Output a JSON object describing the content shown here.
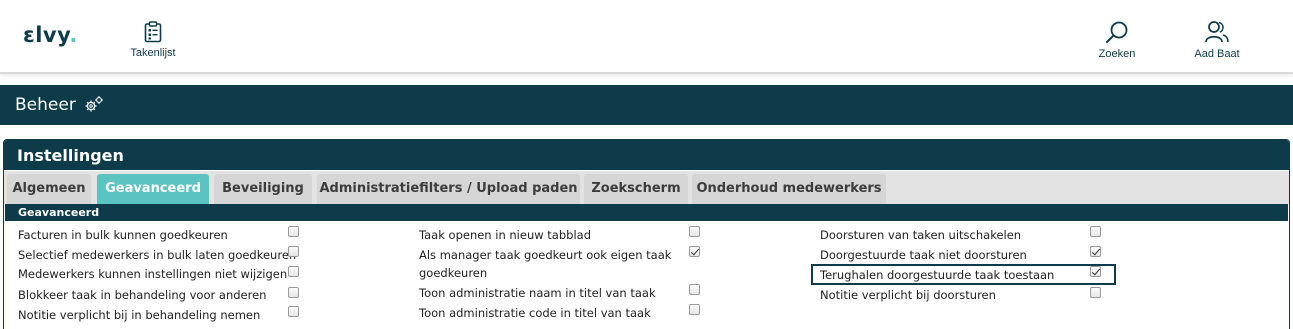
{
  "header": {
    "logo_text": "ɛlvy",
    "nav": {
      "tasks_label": "Takenlijst",
      "search_label": "Zoeken",
      "user_label": "Aad Baat"
    }
  },
  "beheer": {
    "title": "Beheer"
  },
  "panel": {
    "title": "Instellingen",
    "tabs": [
      {
        "label": "Algemeen",
        "active": false
      },
      {
        "label": "Geavanceerd",
        "active": true
      },
      {
        "label": "Beveiliging",
        "active": false
      },
      {
        "label": "Administratiefilters / Upload paden",
        "active": false
      },
      {
        "label": "Zoekscherm",
        "active": false
      },
      {
        "label": "Onderhoud medewerkers",
        "active": false
      }
    ],
    "section_title": "Geavanceerd",
    "options": {
      "col1": [
        {
          "label": "Facturen in bulk kunnen goedkeuren",
          "checked": false
        },
        {
          "label": "Selectief medewerkers in bulk laten goedkeuren",
          "checked": false
        },
        {
          "label": "Medewerkers kunnen instellingen niet wijzigen",
          "checked": false
        },
        {
          "label": "Blokkeer taak in behandeling voor anderen",
          "checked": false
        },
        {
          "label": "Notitie verplicht bij in behandeling nemen",
          "checked": false
        }
      ],
      "col2": [
        {
          "label": "Taak openen in nieuw tabblad",
          "checked": false
        },
        {
          "label": "Als manager taak goedkeurt ook eigen taak goedkeuren",
          "checked": true
        },
        {
          "label": "Toon administratie naam in titel van taak",
          "checked": false
        },
        {
          "label": "Toon administratie code in titel van taak",
          "checked": false
        }
      ],
      "col3": [
        {
          "label": "Doorsturen van taken uitschakelen",
          "checked": false
        },
        {
          "label": "Doorgestuurde taak niet doorsturen",
          "checked": true
        },
        {
          "label": "Terughalen doorgestuurde taak toestaan",
          "checked": true,
          "highlighted": true
        },
        {
          "label": "Notitie verplicht bij doorsturen",
          "checked": false
        }
      ]
    }
  },
  "colors": {
    "primary": "#0d3b4a",
    "accent": "#5bc4c1"
  }
}
